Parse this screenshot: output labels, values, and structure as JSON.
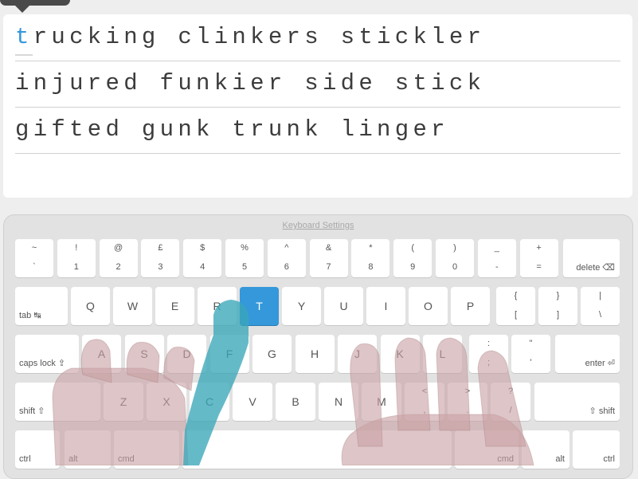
{
  "lines": {
    "line1_current": "t",
    "line1_rest": "rucking clinkers stickler",
    "line2": "injured funkier side stick",
    "line3": "gifted gunk trunk linger"
  },
  "keyboard": {
    "settings_label": "Keyboard Settings",
    "row1": [
      {
        "top": "~",
        "bot": "`"
      },
      {
        "top": "!",
        "bot": "1"
      },
      {
        "top": "@",
        "bot": "2"
      },
      {
        "top": "£",
        "bot": "3"
      },
      {
        "top": "$",
        "bot": "4"
      },
      {
        "top": "%",
        "bot": "5"
      },
      {
        "top": "^",
        "bot": "6"
      },
      {
        "top": "&",
        "bot": "7"
      },
      {
        "top": "*",
        "bot": "8"
      },
      {
        "top": "(",
        "bot": "9"
      },
      {
        "top": ")",
        "bot": "0"
      },
      {
        "top": "_",
        "bot": "-"
      },
      {
        "top": "+",
        "bot": "="
      }
    ],
    "delete_label": "delete ⌫",
    "tab_label": "tab ↹",
    "row2": [
      "Q",
      "W",
      "E",
      "R",
      "T",
      "Y",
      "U",
      "I",
      "O",
      "P"
    ],
    "row2_sym": [
      {
        "top": "{",
        "bot": "["
      },
      {
        "top": "}",
        "bot": "]"
      },
      {
        "top": "|",
        "bot": "\\"
      }
    ],
    "caps_label": "caps lock ⇪",
    "row3": [
      "A",
      "S",
      "D",
      "F",
      "G",
      "H",
      "J",
      "K",
      "L"
    ],
    "row3_sym": [
      {
        "top": ":",
        "bot": ";"
      },
      {
        "top": "\"",
        "bot": "'"
      }
    ],
    "enter_label": "enter ⏎",
    "shift_left_label": "shift ⇧",
    "row4": [
      "Z",
      "X",
      "C",
      "V",
      "B",
      "N",
      "M"
    ],
    "row4_sym": [
      {
        "top": "<",
        "bot": ","
      },
      {
        "top": ">",
        "bot": "."
      },
      {
        "top": "?",
        "bot": "/"
      }
    ],
    "shift_right_label": "⇧ shift",
    "ctrl_label": "ctrl",
    "alt_label": "alt",
    "cmd_label": "cmd",
    "active_key": "T",
    "active_color": "#3598db"
  },
  "colors": {
    "highlight_finger": "#3aa6b9",
    "hand_overlay": "#c9a2a4"
  }
}
